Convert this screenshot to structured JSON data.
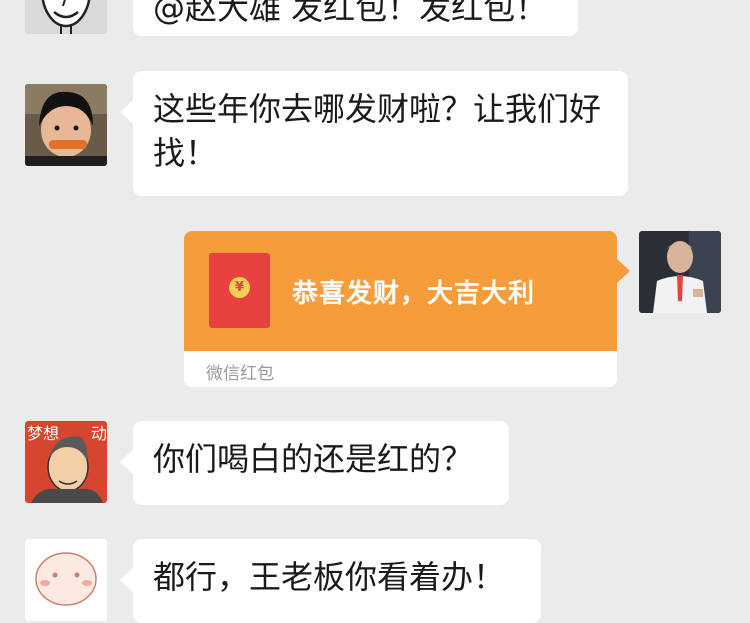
{
  "messages": [
    {
      "side": "left",
      "avatar": "man-cartoon-avatar",
      "text": "@赵大雄 发红包！发红包！"
    },
    {
      "side": "left",
      "avatar": "child-eating-avatar",
      "text": "这些年你去哪发财啦？让我们好找！"
    },
    {
      "side": "right",
      "avatar": "man-white-shirt-avatar",
      "type": "red-packet",
      "title": "恭喜发财，大吉大利",
      "label": "微信红包",
      "coin_symbol": "¥"
    },
    {
      "side": "left",
      "avatar": "mengxiang-cartoon-avatar",
      "avatar_text": "梦想",
      "avatar_text2": "动",
      "text": "你们喝白的还是红的？"
    },
    {
      "side": "left",
      "avatar": "bunny-cartoon-avatar",
      "text": "都行，王老板你看着办！"
    }
  ],
  "colors": {
    "background": "#ebebeb",
    "bubble": "#ffffff",
    "red_packet": "#f79c3a",
    "envelope": "#e64340",
    "coin": "#f6cd55"
  }
}
